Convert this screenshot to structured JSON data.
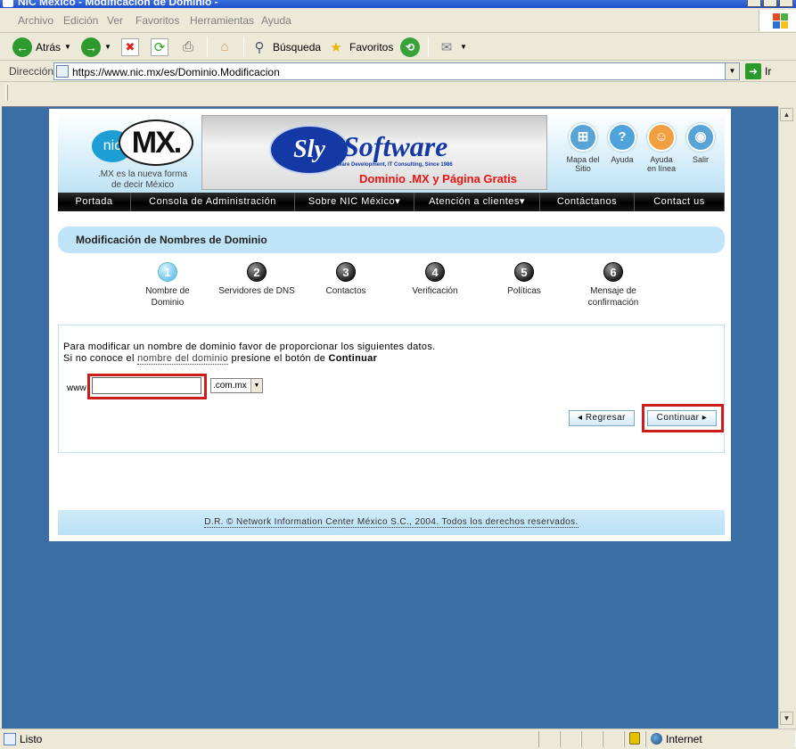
{
  "window": {
    "title": "NIC México - Modificación de Dominio -"
  },
  "menu": [
    "Archivo",
    "Edición",
    "Ver",
    "Favoritos",
    "Herramientas",
    "Ayuda"
  ],
  "toolbar": {
    "back_label": "Atrás",
    "search_label": "Búsqueda",
    "favorites_label": "Favoritos"
  },
  "address": {
    "label": "Dirección",
    "url": "https://www.nic.mx/es/Dominio.Modificacion",
    "go_label": "Ir"
  },
  "site": {
    "logo_nic": "nic",
    "logo_mx": "MX.",
    "tagline_1": ".MX es la nueva forma",
    "tagline_2": "de decir México",
    "banner_brand_1": "Sly",
    "banner_brand_2": "Software",
    "banner_sub": "Software Development, IT Consulting, Since 1986",
    "banner_promo": "Dominio .MX y Página Gratis",
    "header_links": [
      {
        "l1": "Mapa del",
        "l2": "Sitio",
        "icon": "sitemap-icon",
        "color": "#5aa3d6"
      },
      {
        "l1": "Ayuda",
        "l2": "",
        "icon": "help-icon",
        "color": "#4ea3dd"
      },
      {
        "l1": "Ayuda",
        "l2": "en línea",
        "icon": "online-help-icon",
        "color": "#f0a040"
      },
      {
        "l1": "Salir",
        "l2": "",
        "icon": "exit-icon",
        "color": "#5aa3d6"
      }
    ],
    "nav": [
      {
        "label": "Portada",
        "w": 82
      },
      {
        "label": "Consola de Administración",
        "w": 184
      },
      {
        "label": "Sobre NIC México▾",
        "w": 134
      },
      {
        "label": "Atención a clientes▾",
        "w": 141
      },
      {
        "label": "Contáctanos",
        "w": 106
      },
      {
        "label": "Contact us",
        "w": 101
      }
    ],
    "section_title": "Modificación de Nombres de Dominio",
    "steps": [
      {
        "num": "1",
        "l1": "Nombre de",
        "l2": "Dominio",
        "active": true
      },
      {
        "num": "2",
        "l1": "Servidores de DNS",
        "l2": "",
        "active": false
      },
      {
        "num": "3",
        "l1": "Contactos",
        "l2": "",
        "active": false
      },
      {
        "num": "4",
        "l1": "Verificación",
        "l2": "",
        "active": false
      },
      {
        "num": "5",
        "l1": "Políticas",
        "l2": "",
        "active": false
      },
      {
        "num": "6",
        "l1": "Mensaje de",
        "l2": "confirmación",
        "active": false
      }
    ],
    "form": {
      "instruction_1": "Para modificar un nombre de dominio favor de proporcionar los siguientes datos.",
      "instruction_2a": "Si no conoce el ",
      "instruction_2_link": "nombre del dominio",
      "instruction_2b": " presione el botón de ",
      "instruction_2_bold": "Continuar",
      "www_label": "www",
      "domain_value": "",
      "tld_selected": ".com.mx",
      "back_button": "◂ Regresar",
      "continue_button": "Continuar ▸"
    },
    "footer": "D.R. © Network Information Center México S.C., 2004. Todos los derechos reservados."
  },
  "status": {
    "text": "Listo",
    "zone": "Internet"
  }
}
